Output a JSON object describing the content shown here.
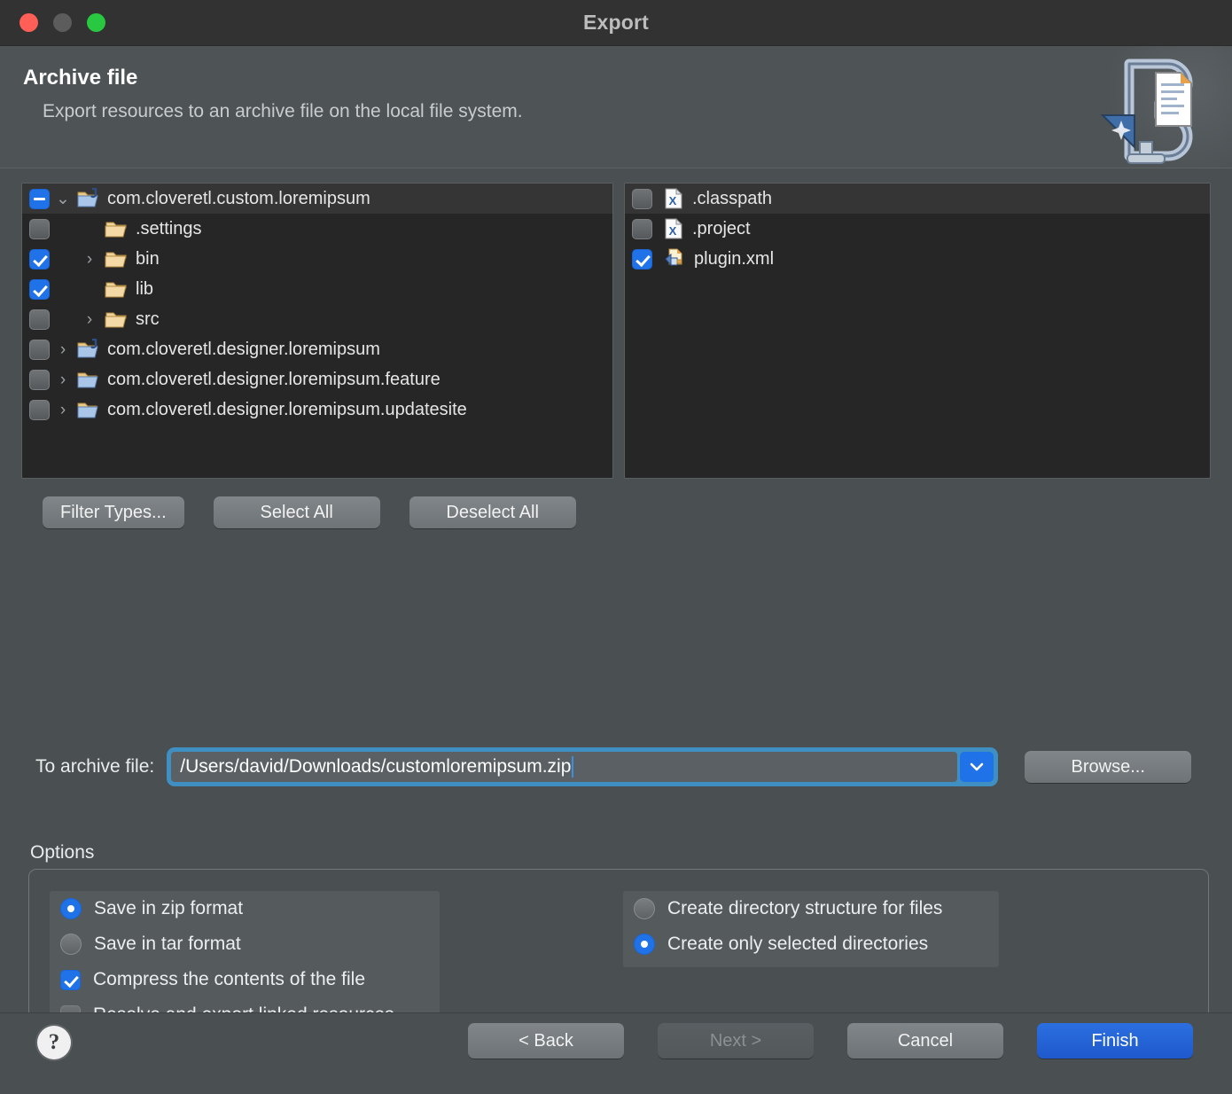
{
  "window": {
    "title": "Export",
    "traffic_lights": [
      "close-button",
      "minimize-button",
      "zoom-button"
    ]
  },
  "header": {
    "title": "Archive file",
    "subtitle": "Export resources to an archive file on the local file system.",
    "icon": "archive-export-wizard-icon"
  },
  "resource_tree": {
    "rows": [
      {
        "label": "com.cloveretl.custom.loremipsum",
        "check": "partial",
        "twisty": "expanded",
        "icon": "java-project-icon",
        "indent": 0,
        "selected": true
      },
      {
        "label": ".settings",
        "check": "off",
        "twisty": "none",
        "icon": "folder-icon",
        "indent": 1,
        "selected": false
      },
      {
        "label": "bin",
        "check": "on",
        "twisty": "collapsed",
        "icon": "folder-icon",
        "indent": 1,
        "selected": false
      },
      {
        "label": "lib",
        "check": "on",
        "twisty": "none",
        "icon": "folder-icon",
        "indent": 1,
        "selected": false
      },
      {
        "label": "src",
        "check": "off",
        "twisty": "collapsed",
        "icon": "folder-icon",
        "indent": 1,
        "selected": false
      },
      {
        "label": "com.cloveretl.designer.loremipsum",
        "check": "off",
        "twisty": "collapsed",
        "icon": "java-project-icon",
        "indent": 0,
        "selected": false
      },
      {
        "label": "com.cloveretl.designer.loremipsum.feature",
        "check": "off",
        "twisty": "collapsed",
        "icon": "project-icon",
        "indent": 0,
        "selected": false
      },
      {
        "label": "com.cloveretl.designer.loremipsum.updatesite",
        "check": "off",
        "twisty": "collapsed",
        "icon": "project-icon",
        "indent": 0,
        "selected": false
      }
    ]
  },
  "file_list": {
    "rows": [
      {
        "label": ".classpath",
        "check": "off",
        "icon": "xml-file-icon",
        "selected": true
      },
      {
        "label": ".project",
        "check": "off",
        "icon": "xml-file-icon",
        "selected": false
      },
      {
        "label": "plugin.xml",
        "check": "on",
        "icon": "plugin-file-icon",
        "selected": false
      }
    ]
  },
  "selection_buttons": {
    "filter_types": "Filter Types...",
    "select_all": "Select All",
    "deselect_all": "Deselect All"
  },
  "archive": {
    "label": "To archive file:",
    "value": "/Users/david/Downloads/customloremipsum.zip",
    "placeholder": "",
    "dropdown_icon": "chevron-down-icon",
    "browse": "Browse..."
  },
  "options": {
    "title": "Options",
    "left": [
      {
        "type": "radio",
        "label": "Save in zip format",
        "state": "on"
      },
      {
        "type": "radio",
        "label": "Save in tar format",
        "state": "off"
      },
      {
        "type": "checkbox",
        "label": "Compress the contents of the file",
        "state": "on"
      },
      {
        "type": "checkbox",
        "label": "Resolve and export linked resources",
        "state": "off"
      }
    ],
    "right": [
      {
        "type": "radio",
        "label": "Create directory structure for files",
        "state": "off"
      },
      {
        "type": "radio",
        "label": "Create only selected directories",
        "state": "on"
      }
    ]
  },
  "footer": {
    "help": "?",
    "back": "< Back",
    "next": "Next >",
    "cancel": "Cancel",
    "finish": "Finish"
  },
  "colors": {
    "accent": "#1f72e8",
    "primary_button": "#2b6fe0",
    "dialog_bg": "#4a4f52",
    "tree_bg": "#262626",
    "focus_ring": "#3f8fc2"
  }
}
